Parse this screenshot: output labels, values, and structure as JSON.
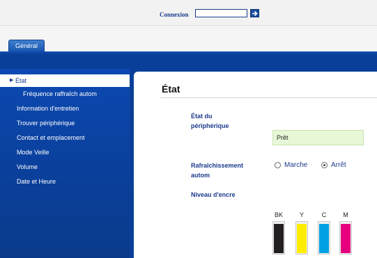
{
  "login": {
    "label": "Connexion",
    "input_value": ""
  },
  "tabs": [
    {
      "label": "Général"
    }
  ],
  "sidebar": {
    "items": [
      {
        "label": "État",
        "active": true
      },
      {
        "label": "Fréquence raffraîch autom"
      },
      {
        "label": "Information d'entretien"
      },
      {
        "label": "Trouver périphérique"
      },
      {
        "label": "Contact et emplacement"
      },
      {
        "label": "Mode Veille"
      },
      {
        "label": "Volume"
      },
      {
        "label": "Date et Heure"
      }
    ]
  },
  "main": {
    "title": "État",
    "device_status": {
      "label_line1": "État du",
      "label_line2": "périphérique",
      "value": "Prêt"
    },
    "auto_refresh": {
      "label_line1": "Rafraîchissement",
      "label_line2": "autom",
      "options": [
        {
          "label": "Marche",
          "selected": false
        },
        {
          "label": "Arrêt",
          "selected": true
        }
      ]
    },
    "ink": {
      "label": "Niveau d'encre",
      "cartridges": [
        {
          "name": "BK",
          "color": "#231f20",
          "level": 0.95
        },
        {
          "name": "Y",
          "color": "#ffed00",
          "level": 0.95
        },
        {
          "name": "C",
          "color": "#00a0e3",
          "level": 0.95
        },
        {
          "name": "M",
          "color": "#e6007e",
          "level": 0.95
        }
      ]
    }
  },
  "colors": {
    "brand_blue": "#0a3f99",
    "status_bg": "#e6f8d6"
  }
}
